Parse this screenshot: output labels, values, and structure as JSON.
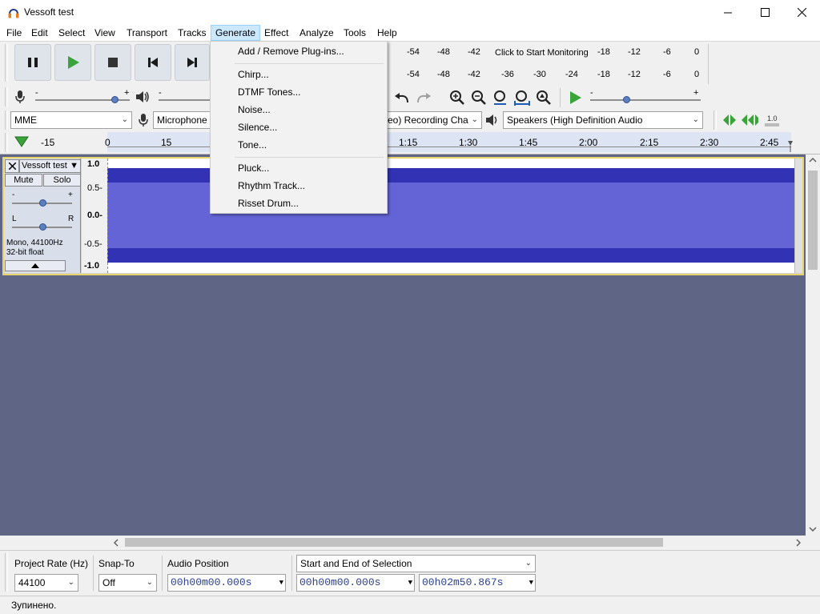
{
  "app": {
    "title": "Vessoft test"
  },
  "menubar": [
    "File",
    "Edit",
    "Select",
    "View",
    "Transport",
    "Tracks",
    "Generate",
    "Effect",
    "Analyze",
    "Tools",
    "Help"
  ],
  "generate_menu": {
    "group1": [
      "Add / Remove Plug-ins..."
    ],
    "group2": [
      "Chirp...",
      "DTMF Tones...",
      "Noise...",
      "Silence...",
      "Tone..."
    ],
    "group3": [
      "Pluck...",
      "Rhythm Track...",
      "Risset Drum..."
    ]
  },
  "meters": {
    "record_ticks": [
      "-54",
      "-48",
      "-42",
      "Click to Start Monitoring",
      "-18",
      "-12",
      "-6",
      "0"
    ],
    "play_ticks": [
      "-54",
      "-48",
      "-42",
      "-36",
      "-30",
      "-24",
      "-18",
      "-12",
      "-6",
      "0"
    ]
  },
  "device": {
    "host": "MME",
    "input": "Microphone",
    "channels": "eo) Recording Cha",
    "output": "Speakers (High Definition Audio"
  },
  "ruler": {
    "labels": [
      "-15",
      "0",
      "15",
      "1:15",
      "1:30",
      "1:45",
      "2:00",
      "2:15",
      "2:30",
      "2:45"
    ]
  },
  "track": {
    "name": "Vessoft test",
    "mute": "Mute",
    "solo": "Solo",
    "gain_minus": "-",
    "gain_plus": "+",
    "pan_left": "L",
    "pan_right": "R",
    "info_line1": "Mono, 44100Hz",
    "info_line2": "32-bit float",
    "vruler": [
      "1.0",
      "0.5-",
      "0.0-",
      "-0.5-",
      "-1.0"
    ]
  },
  "selection_toolbar": {
    "rate_label": "Project Rate (Hz)",
    "rate_value": "44100",
    "snap_label": "Snap-To",
    "snap_value": "Off",
    "position_label": "Audio Position",
    "position_value": "00h00m00.000s",
    "selection_mode": "Start and End of Selection",
    "start_value": "00h00m00.000s",
    "end_value": "00h02m50.867s"
  },
  "status": {
    "text": "Зупинено."
  },
  "colors": {
    "wave_fill": "#6464d6",
    "wave_dark": "#3232b4",
    "track_bg": "#5f6584",
    "accent": "#3b9b3b"
  }
}
